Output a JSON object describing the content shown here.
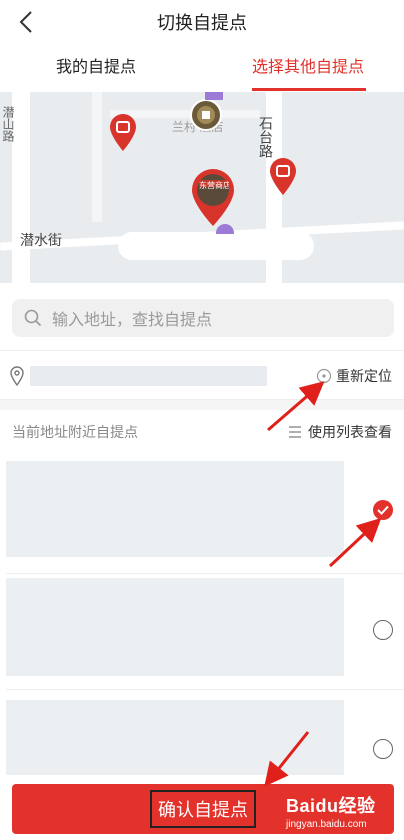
{
  "header": {
    "title": "切换自提点"
  },
  "tabs": [
    {
      "label": "我的自提点",
      "active": false
    },
    {
      "label": "选择其他自提点",
      "active": true
    }
  ],
  "map": {
    "streets": [
      "潜水街",
      "石台路",
      "潜山路"
    ],
    "poi": "兰村 酒店",
    "store_sign": "东营商店"
  },
  "search": {
    "placeholder": "输入地址，查找自提点"
  },
  "address": {
    "relocate_label": "重新定位"
  },
  "nearby": {
    "title": "当前地址附近自提点",
    "list_view_label": "使用列表查看"
  },
  "stores": [
    {
      "selected": true
    },
    {
      "selected": false
    },
    {
      "selected": false
    }
  ],
  "confirm_button": "确认自提点",
  "watermark": {
    "brand": "Baidu经验",
    "url": "jingyan.baidu.com"
  },
  "colors": {
    "accent": "#e3322b",
    "map_bg": "#e9ecef",
    "placeholder_block": "#eceff2"
  }
}
